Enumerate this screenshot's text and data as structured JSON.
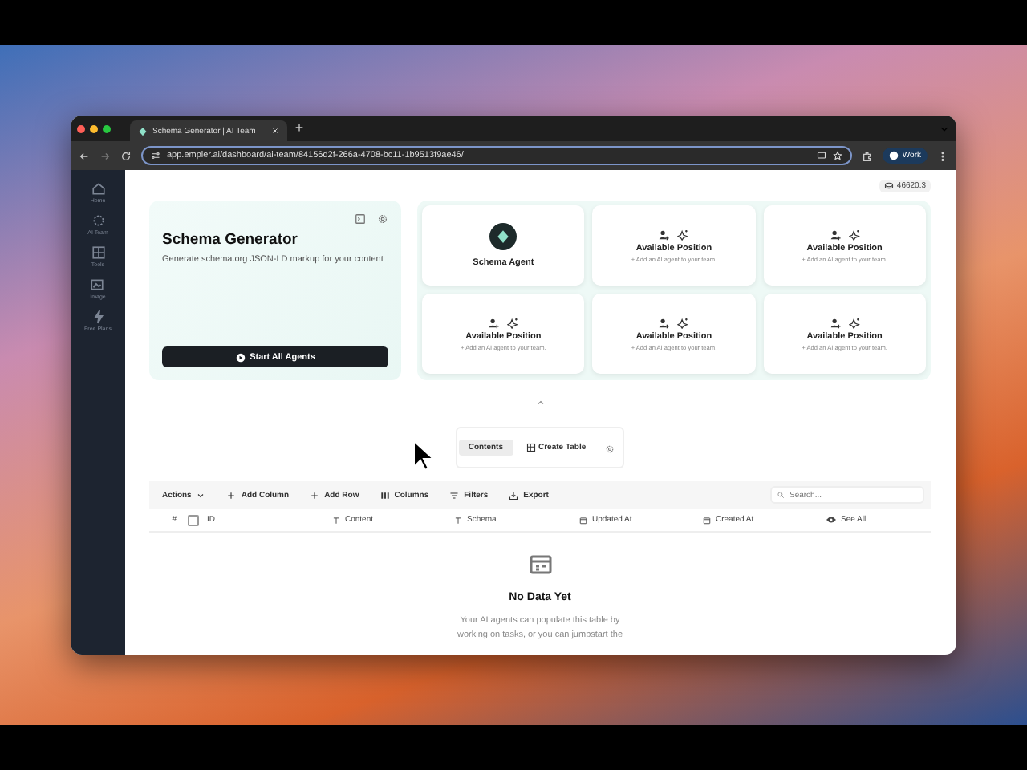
{
  "browser": {
    "tab_title": "Schema Generator | AI Team",
    "url": "app.empler.ai/dashboard/ai-team/84156d2f-266a-4708-bc11-1b9513f9ae46/",
    "profile": "Work"
  },
  "sidebar": {
    "items": [
      {
        "label": "Home"
      },
      {
        "label": "AI Team"
      },
      {
        "label": "Tools"
      },
      {
        "label": "Image"
      },
      {
        "label": "Free Plans"
      }
    ]
  },
  "credits": "46620.3",
  "hero": {
    "title": "Schema Generator",
    "description": "Generate schema.org JSON-LD markup for your content",
    "button": "Start All Agents"
  },
  "agents": [
    {
      "kind": "agent",
      "name": "Schema Agent"
    },
    {
      "kind": "position",
      "title": "Available Position",
      "hint": "+ Add an AI agent to your team."
    },
    {
      "kind": "position",
      "title": "Available Position",
      "hint": "+ Add an AI agent to your team."
    },
    {
      "kind": "position",
      "title": "Available Position",
      "hint": "+ Add an AI agent to your team."
    },
    {
      "kind": "position",
      "title": "Available Position",
      "hint": "+ Add an AI agent to your team."
    },
    {
      "kind": "position",
      "title": "Available Position",
      "hint": "+ Add an AI agent to your team."
    }
  ],
  "view_tabs": [
    {
      "label": "Contents",
      "selected": true
    },
    {
      "label": "Create Table",
      "selected": false
    }
  ],
  "toolbar": {
    "buttons": [
      {
        "kind": "dropdown",
        "label": "Actions"
      },
      {
        "kind": "plus",
        "label": "Add Column"
      },
      {
        "kind": "plus",
        "label": "Add Row"
      },
      {
        "kind": "columns",
        "label": "Columns"
      },
      {
        "kind": "filter",
        "label": "Filters"
      },
      {
        "kind": "export",
        "label": "Export"
      }
    ],
    "search": {
      "placeholder": "Search..."
    }
  },
  "table": {
    "columns": [
      {
        "kind": "index",
        "label": "#"
      },
      {
        "kind": "checkbox",
        "checked": false
      },
      {
        "kind": "plain",
        "label": "ID"
      },
      {
        "kind": "text",
        "label": "Content"
      },
      {
        "kind": "text",
        "label": "Schema"
      },
      {
        "kind": "date",
        "label": "Updated At"
      },
      {
        "kind": "date",
        "label": "Created At"
      },
      {
        "kind": "view",
        "label": "See All"
      }
    ]
  },
  "empty_state": {
    "title": "No Data Yet",
    "message": [
      "Your AI agents can populate this table by",
      "working on tasks, or you can jumpstart the"
    ]
  }
}
